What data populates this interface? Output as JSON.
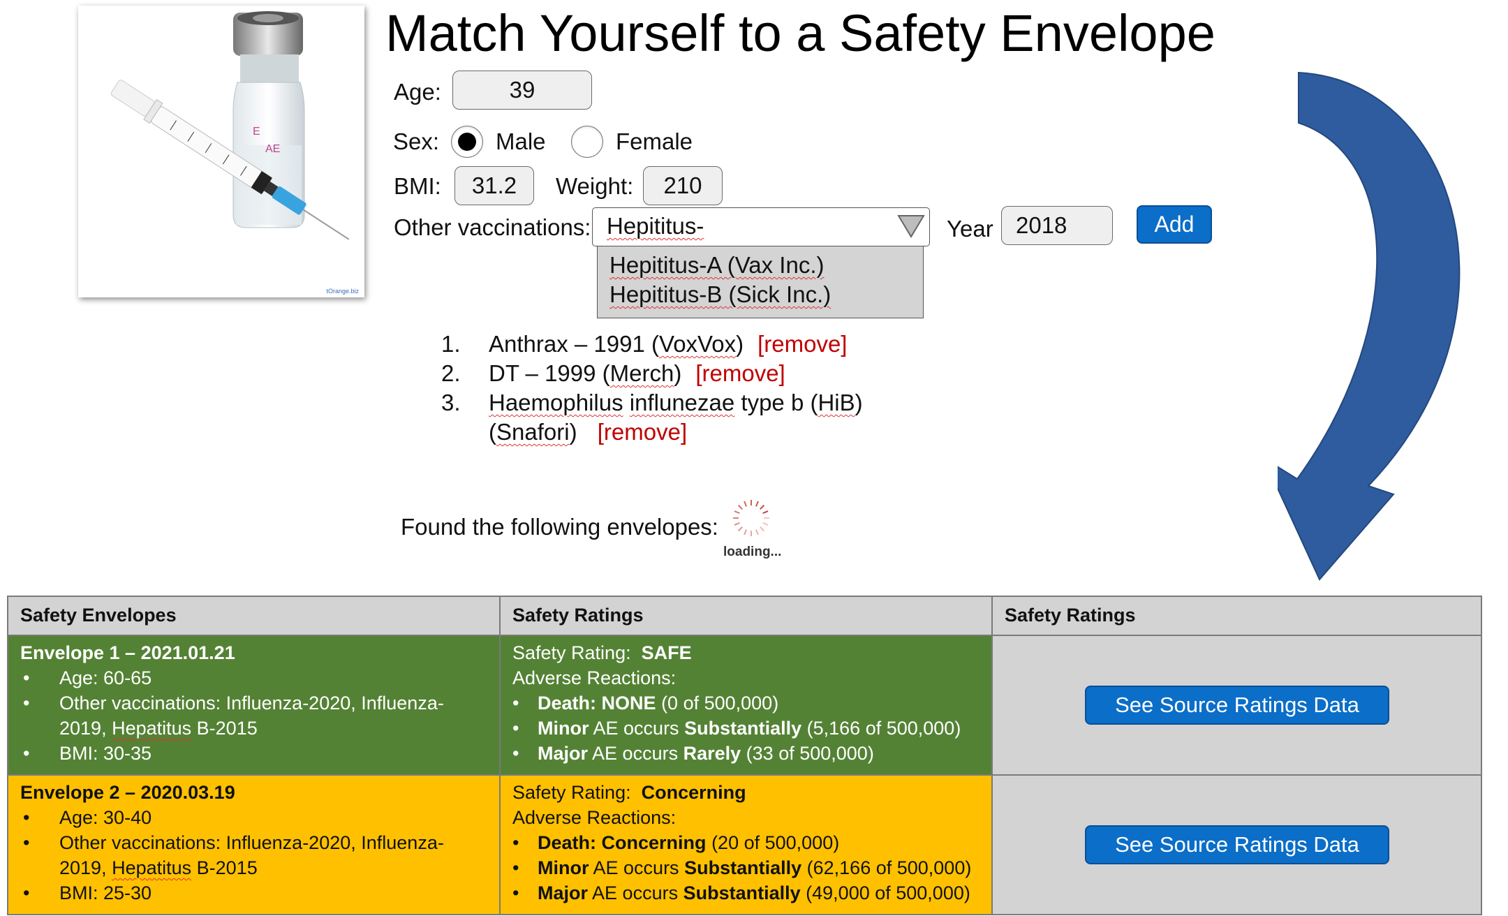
{
  "page": {
    "title": "Match Yourself to a Safety Envelope"
  },
  "image": {
    "watermark": "tOrange.biz"
  },
  "form": {
    "age_label": "Age:",
    "age_value": "39",
    "sex_label": "Sex:",
    "sex_options": [
      {
        "label": "Male",
        "selected": true
      },
      {
        "label": "Female",
        "selected": false
      }
    ],
    "bmi_label": "BMI:",
    "bmi_value": "31.2",
    "weight_label": "Weight:",
    "weight_value": "210",
    "other_vacc_label": "Other vaccinations:",
    "other_vacc_value": "Hepititus-",
    "other_vacc_suggestions": [
      "Hepititus-A (Vax Inc.)",
      "Hepititus-B (Sick Inc.)"
    ],
    "year_label": "Year",
    "year_value": "2018",
    "add_button": "Add"
  },
  "vaccinations": [
    {
      "num": "1.",
      "text": "Anthrax – 1991 (VoxVox)",
      "remove": "[remove]"
    },
    {
      "num": "2.",
      "text": "DT – 1999 (Merch)",
      "remove": "[remove]"
    },
    {
      "num": "3.",
      "line1": "Haemophilus influnezae type b (HiB)",
      "line2": "(Snafori)",
      "remove": "[remove]"
    }
  ],
  "results": {
    "found_label": "Found the following envelopes:",
    "loading_text": "loading..."
  },
  "table": {
    "headers": [
      "Safety Envelopes",
      "Safety Ratings",
      "Safety Ratings"
    ],
    "rows": [
      {
        "color": "#548235",
        "envelope_title": "Envelope 1 – 2021.01.21",
        "age": "Age:  60-65",
        "other_vacc": "Other vaccinations:  Influenza-2020, Influenza-2019, Hepatitus B-2015",
        "bmi": "BMI:  30-35",
        "rating_label": "Safety Rating:",
        "rating_value": "SAFE",
        "ar_label": "Adverse Reactions:",
        "death_label": "Death",
        "death_value": "NONE",
        "death_count": "(0 of 500,000)",
        "minor_label": "Minor",
        "minor_text": "AE occurs",
        "minor_freq": "Substantially",
        "minor_count": "(5,166 of 500,000)",
        "major_label": "Major",
        "major_text": "AE occurs",
        "major_freq": "Rarely",
        "major_count": "(33 of 500,000)",
        "button": "See Source Ratings Data"
      },
      {
        "color": "#ffc000",
        "envelope_title": "Envelope 2 – 2020.03.19",
        "age": "Age:  30-40",
        "other_vacc": "Other vaccinations:  Influenza-2020, Influenza-2019, Hepatitus B-2015",
        "bmi": "BMI:  25-30",
        "rating_label": "Safety Rating:",
        "rating_value": "Concerning",
        "ar_label": "Adverse Reactions:",
        "death_label": "Death",
        "death_value": "Concerning",
        "death_count": "(20 of 500,000)",
        "minor_label": "Minor",
        "minor_text": "AE occurs",
        "minor_freq": "Substantially",
        "minor_count": "(62,166 of 500,000)",
        "major_label": "Major",
        "major_text": "AE occurs",
        "major_freq": "Substantially",
        "major_count": "(49,000 of 500,000)",
        "button": "See Source Ratings Data"
      }
    ]
  },
  "colors": {
    "accent": "#0b6ec8",
    "remove": "#c00000",
    "arrow": "#2e5c9e"
  }
}
